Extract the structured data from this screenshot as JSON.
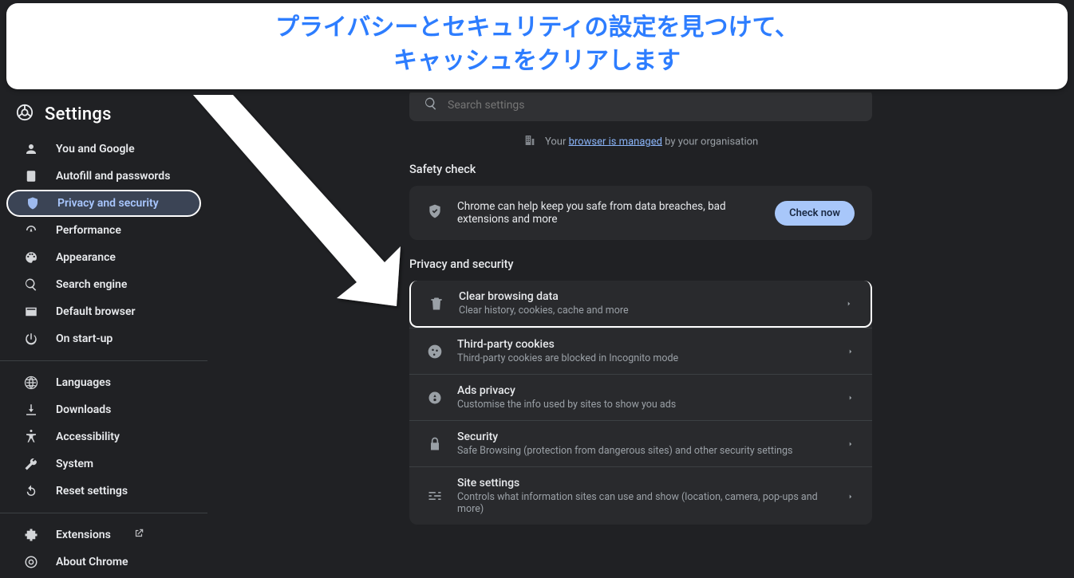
{
  "annotation": {
    "line1": "プライバシーとセキュリティの設定を見つけて、",
    "line2": "キャッシュをクリアします"
  },
  "header": {
    "title": "Settings"
  },
  "search": {
    "placeholder": "Search settings"
  },
  "managed": {
    "prefix": "Your ",
    "link": "browser is managed",
    "suffix": " by your organisation"
  },
  "sidebar": {
    "group1": [
      {
        "label": "You and Google"
      },
      {
        "label": "Autofill and passwords"
      },
      {
        "label": "Privacy and security"
      },
      {
        "label": "Performance"
      },
      {
        "label": "Appearance"
      },
      {
        "label": "Search engine"
      },
      {
        "label": "Default browser"
      },
      {
        "label": "On start-up"
      }
    ],
    "group2": [
      {
        "label": "Languages"
      },
      {
        "label": "Downloads"
      },
      {
        "label": "Accessibility"
      },
      {
        "label": "System"
      },
      {
        "label": "Reset settings"
      }
    ],
    "group3": [
      {
        "label": "Extensions"
      },
      {
        "label": "About Chrome"
      }
    ]
  },
  "safety": {
    "title": "Safety check",
    "text": "Chrome can help keep you safe from data breaches, bad extensions and more",
    "button": "Check now"
  },
  "privacy": {
    "title": "Privacy and security",
    "rows": [
      {
        "title": "Clear browsing data",
        "sub": "Clear history, cookies, cache and more"
      },
      {
        "title": "Third-party cookies",
        "sub": "Third-party cookies are blocked in Incognito mode"
      },
      {
        "title": "Ads privacy",
        "sub": "Customise the info used by sites to show you ads"
      },
      {
        "title": "Security",
        "sub": "Safe Browsing (protection from dangerous sites) and other security settings"
      },
      {
        "title": "Site settings",
        "sub": "Controls what information sites can use and show (location, camera, pop-ups and more)"
      }
    ]
  }
}
